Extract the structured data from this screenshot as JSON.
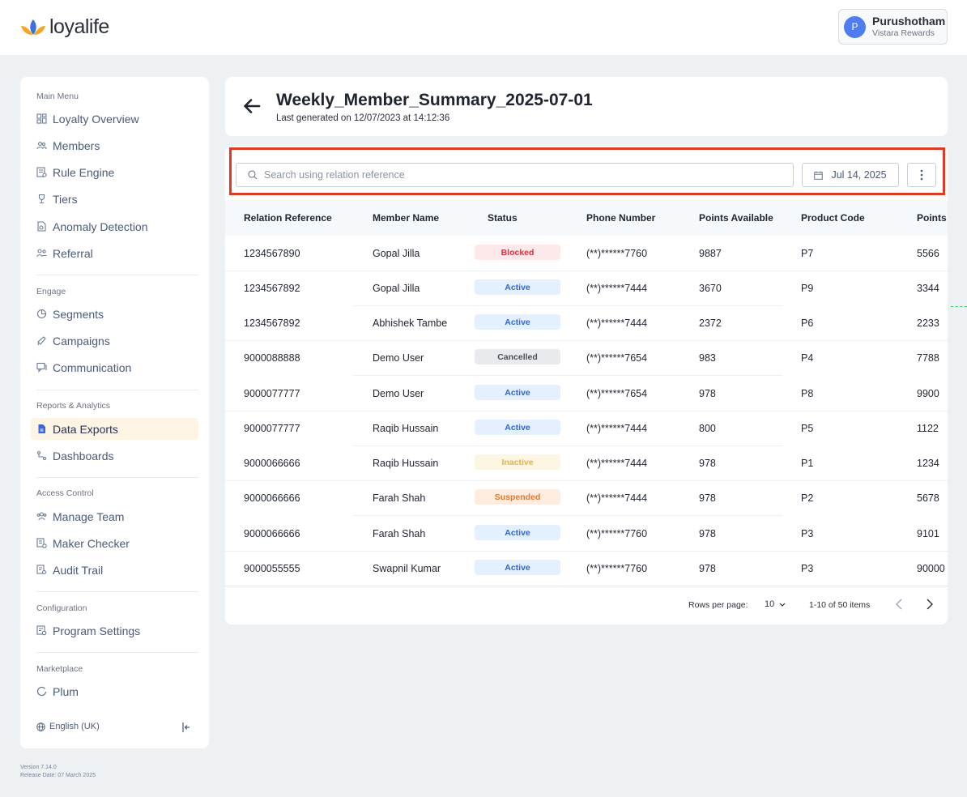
{
  "brand": {
    "name": "loyalife"
  },
  "user": {
    "initial": "P",
    "name": "Purushotham",
    "org": "Vistara Rewards"
  },
  "sidebar": {
    "sections": [
      {
        "title": "Main Menu",
        "items": [
          {
            "label": "Loyalty Overview",
            "icon": "dashboard-icon"
          },
          {
            "label": "Members",
            "icon": "members-icon"
          },
          {
            "label": "Rule Engine",
            "icon": "rule-engine-icon"
          },
          {
            "label": "Tiers",
            "icon": "trophy-icon"
          },
          {
            "label": "Anomaly Detection",
            "icon": "anomaly-icon"
          },
          {
            "label": "Referral",
            "icon": "referral-icon"
          }
        ]
      },
      {
        "title": "Engage",
        "items": [
          {
            "label": "Segments",
            "icon": "pie-chart-icon"
          },
          {
            "label": "Campaigns",
            "icon": "megaphone-icon"
          },
          {
            "label": "Communication",
            "icon": "chat-icon"
          }
        ]
      },
      {
        "title": "Reports & Analytics",
        "items": [
          {
            "label": "Data Exports",
            "icon": "file-icon",
            "active": true
          },
          {
            "label": "Dashboards",
            "icon": "flow-icon"
          }
        ]
      },
      {
        "title": "Access Control",
        "items": [
          {
            "label": "Manage Team",
            "icon": "team-icon"
          },
          {
            "label": "Maker Checker",
            "icon": "maker-checker-icon"
          },
          {
            "label": "Audit Trail",
            "icon": "audit-icon"
          }
        ]
      },
      {
        "title": "Configuration",
        "items": [
          {
            "label": "Program Settings",
            "icon": "settings-icon"
          }
        ]
      },
      {
        "title": "Marketplace",
        "items": [
          {
            "label": "Plum",
            "icon": "plum-icon"
          }
        ]
      }
    ],
    "language": "English (UK)"
  },
  "version": {
    "line1": "Version 7.14.0",
    "line2": "Release Date: 07 March 2025"
  },
  "header": {
    "title": "Weekly_Member_Summary_2025-07-01",
    "subtitle": "Last generated on 12/07/2023 at 14:12:36"
  },
  "toolbar": {
    "search_placeholder": "Search using relation reference",
    "date_label": "Jul 14, 2025"
  },
  "table": {
    "columns": [
      "Relation Reference",
      "Member Name",
      "Status",
      "Phone Number",
      "Points Available",
      "Product Code",
      "Points"
    ],
    "rows": [
      {
        "ref": "1234567890",
        "name": "Gopal Jilla",
        "status": "Blocked",
        "phone": "(**)******7760",
        "points_available": "9887",
        "product": "P7",
        "points": "5566"
      },
      {
        "ref": "1234567892",
        "name": "Gopal Jilla",
        "status": "Active",
        "phone": "(**)******7444",
        "points_available": "3670",
        "product": "P9",
        "points": "3344"
      },
      {
        "ref": "1234567892",
        "name": "Abhishek Tambe",
        "status": "Active",
        "phone": "(**)******7444",
        "points_available": "2372",
        "product": "P6",
        "points": "2233"
      },
      {
        "ref": "9000088888",
        "name": "Demo User",
        "status": "Cancelled",
        "phone": "(**)******7654",
        "points_available": "983",
        "product": "P4",
        "points": "7788"
      },
      {
        "ref": "9000077777",
        "name": "Demo User",
        "status": "Active",
        "phone": "(**)******7654",
        "points_available": "978",
        "product": "P8",
        "points": "9900"
      },
      {
        "ref": "9000077777",
        "name": "Raqib Hussain",
        "status": "Active",
        "phone": "(**)******7444",
        "points_available": "800",
        "product": "P5",
        "points": "1122"
      },
      {
        "ref": "9000066666",
        "name": "Raqib Hussain",
        "status": "Inactive",
        "phone": "(**)******7444",
        "points_available": "978",
        "product": "P1",
        "points": "1234"
      },
      {
        "ref": "9000066666",
        "name": "Farah Shah",
        "status": "Suspended",
        "phone": "(**)******7444",
        "points_available": "978",
        "product": "P2",
        "points": "5678"
      },
      {
        "ref": "9000066666",
        "name": "Farah Shah",
        "status": "Active",
        "phone": "(**)******7760",
        "points_available": "978",
        "product": "P3",
        "points": "9101"
      },
      {
        "ref": "9000055555",
        "name": "Swapnil Kumar",
        "status": "Active",
        "phone": "(**)******7760",
        "points_available": "978",
        "product": "P3",
        "points": "90000"
      }
    ]
  },
  "pagination": {
    "rows_per_page_label": "Rows per page:",
    "rows_per_page": "10",
    "range": "1-10 of 50 items"
  },
  "colors": {
    "highlight": "#e03a24",
    "accent": "#4f7cf0",
    "active_nav_bg": "#fdf4e3"
  }
}
